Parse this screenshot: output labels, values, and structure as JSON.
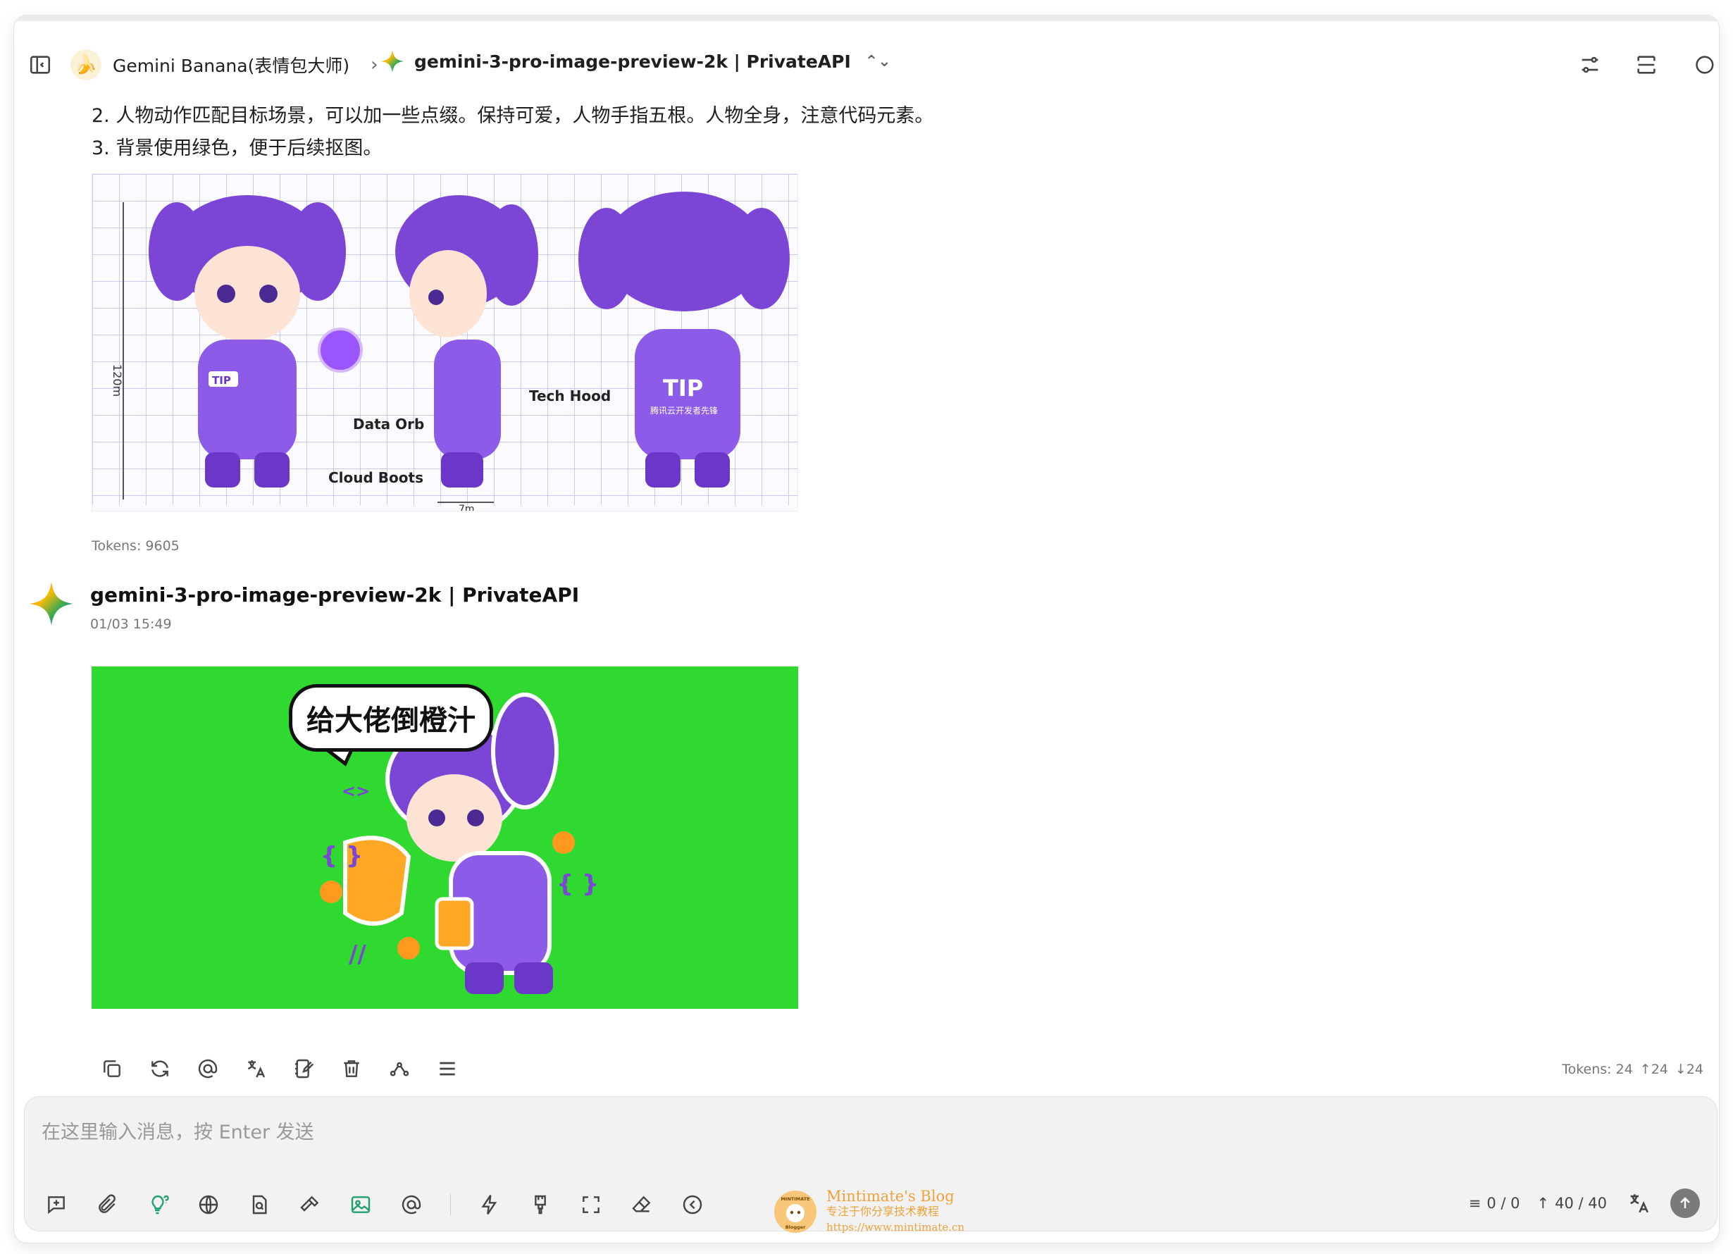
{
  "header": {
    "assistant_name": "Gemini Banana(表情包大师)",
    "model_name": "gemini-3-pro-image-preview-2k | PrivateAPI"
  },
  "prompt": {
    "items": [
      "2. 人物动作匹配目标场景，可以加一些点缀。保持可爱，人物手指五根。人物全身，注意代码元素。",
      "3. 背景使用绿色，便于后续抠图。"
    ]
  },
  "reference_image": {
    "labels": {
      "height": "120m",
      "data_orb": "Data Orb",
      "tech_hood": "Tech Hood",
      "cloud_boots": "Cloud Boots",
      "width": "7m",
      "badge": "TIP",
      "back_text": "腾讯云开发者先锋"
    }
  },
  "user_message": {
    "tokens": "Tokens: 9605"
  },
  "assistant_message": {
    "name": "gemini-3-pro-image-preview-2k | PrivateAPI",
    "time": "01/03 15:49",
    "image_bubble": "给大佬倒橙汁",
    "tokens": "Tokens: 24",
    "tokens_up": "↑24",
    "tokens_down": "↓24"
  },
  "input": {
    "placeholder": "在这里输入消息，按 Enter 发送",
    "context_count": "0 / 0",
    "token_count": "40 / 40"
  },
  "watermark": {
    "title": "Mintimate's Blog",
    "subtitle": "专注于你分享技术教程",
    "url": "https://www.mintimate.cn",
    "logo_text": "MINTIMATE",
    "logo_sub": "Blogger"
  },
  "colors": {
    "accent_green": "#2fd92f",
    "purple": "#7b45d6",
    "send_button": "#7a7a7a"
  }
}
